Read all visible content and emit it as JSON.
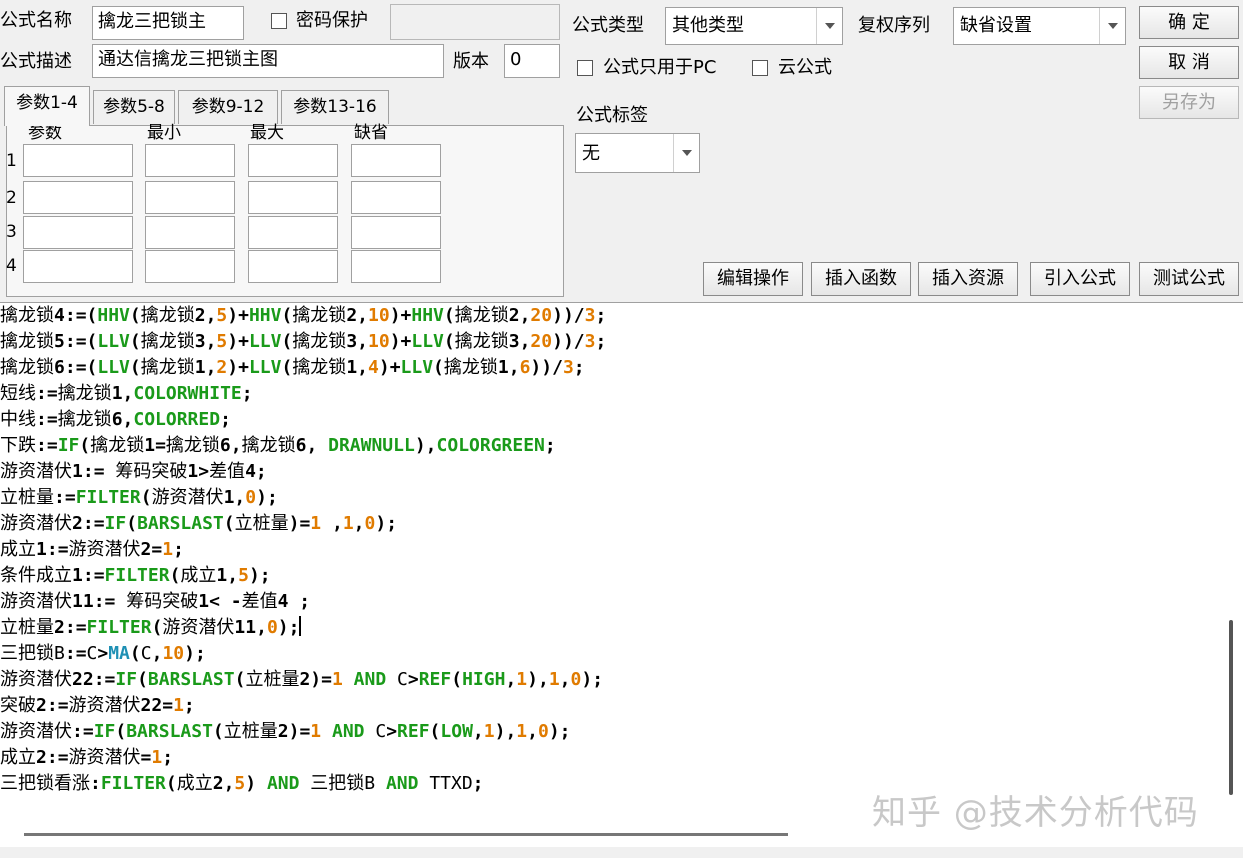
{
  "header": {
    "name_label": "公式名称",
    "name_value": "擒龙三把锁主",
    "password_label": "密码保护",
    "password_value": "",
    "desc_label": "公式描述",
    "desc_value": "通达信擒龙三把锁主图",
    "version_label": "版本",
    "version_value": "0",
    "type_label": "公式类型",
    "type_value": "其他类型",
    "rights_label": "复权序列",
    "rights_value": "缺省设置",
    "pc_only_label": "公式只用于PC",
    "cloud_label": "云公式",
    "tag_label": "公式标签",
    "tag_value": "无"
  },
  "buttons": {
    "ok": "确 定",
    "cancel": "取 消",
    "save_as": "另存为",
    "edit_ops": "编辑操作",
    "insert_func": "插入函数",
    "insert_res": "插入资源",
    "import_formula": "引入公式",
    "test_formula": "测试公式"
  },
  "tabs": [
    "参数1-4",
    "参数5-8",
    "参数9-12",
    "参数13-16"
  ],
  "params": {
    "headers": [
      "参数",
      "最小",
      "最大",
      "缺省"
    ],
    "rows": [
      "1",
      "2",
      "3",
      "4"
    ]
  },
  "code_lines": [
    "擒龙锁4:=(HHV(擒龙锁2,5)+HHV(擒龙锁2,10)+HHV(擒龙锁2,20))/3;",
    "擒龙锁5:=(LLV(擒龙锁3,5)+LLV(擒龙锁3,10)+LLV(擒龙锁3,20))/3;",
    "擒龙锁6:=(LLV(擒龙锁1,2)+LLV(擒龙锁1,4)+LLV(擒龙锁1,6))/3;",
    "短线:=擒龙锁1,COLORWHITE;",
    "中线:=擒龙锁6,COLORRED;",
    "下跌:=IF(擒龙锁1=擒龙锁6,擒龙锁6, DRAWNULL),COLORGREEN;",
    "游资潜伏1:= 筹码突破1>差值4;",
    "立桩量:=FILTER(游资潜伏1,0);",
    "游资潜伏2:=IF(BARSLAST(立桩量)=1 ,1,0);",
    "成立1:=游资潜伏2=1;",
    "条件成立1:=FILTER(成立1,5);",
    "游资潜伏11:= 筹码突破1< -差值4 ;",
    "立桩量2:=FILTER(游资潜伏11,0);",
    "三把锁B:=C>MA(C,10);",
    "游资潜伏22:=IF(BARSLAST(立桩量2)=1 AND C>REF(HIGH,1),1,0);",
    "突破2:=游资潜伏22=1;",
    "游资潜伏:=IF(BARSLAST(立桩量2)=1 AND C>REF(LOW,1),1,0);",
    "成立2:=游资潜伏=1;",
    "三把锁看涨:FILTER(成立2,5) AND 三把锁B AND TTXD;"
  ],
  "watermark": "知乎 @技术分析代码",
  "colors": {
    "keyword": "#1a9a1a",
    "number": "#e07b00",
    "function_ma": "#1e90b4",
    "background": "#f0f0f0"
  }
}
